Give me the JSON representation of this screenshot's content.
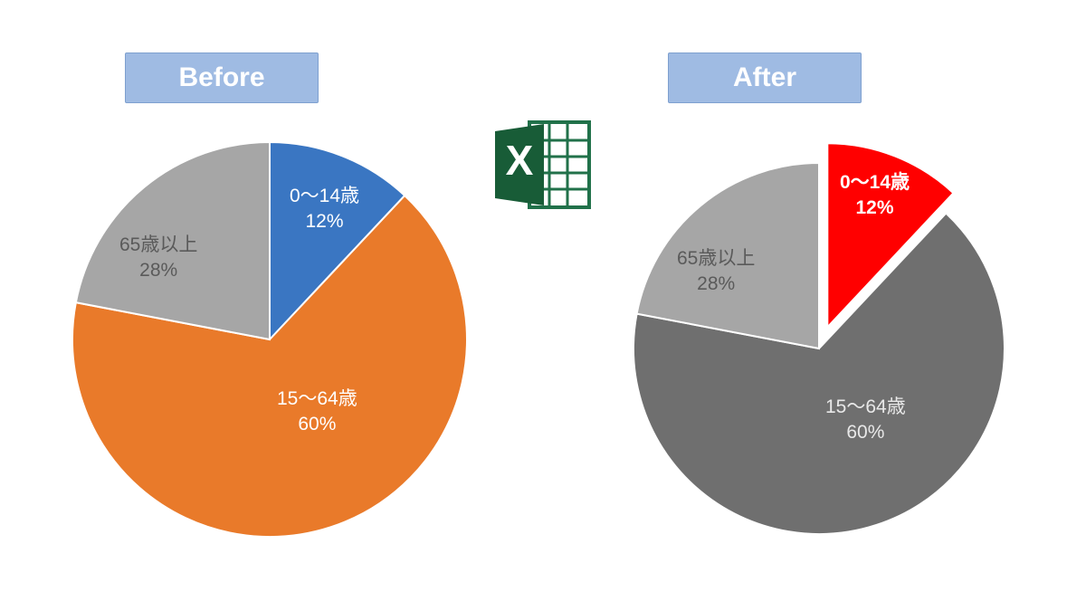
{
  "titles": {
    "before": "Before",
    "after": "After"
  },
  "chart_data": [
    {
      "id": "before",
      "type": "pie",
      "title": "Before",
      "series": [
        {
          "name": "0～14歳",
          "value": 12,
          "label": "12%",
          "color": "#3a76c2"
        },
        {
          "name": "15～64歳",
          "value": 60,
          "label": "60%",
          "color": "#e97a2a"
        },
        {
          "name": "65歳以上",
          "value": 28,
          "label": "28%",
          "color": "#a6a6a6"
        }
      ],
      "exploded_index": null
    },
    {
      "id": "after",
      "type": "pie",
      "title": "After",
      "series": [
        {
          "name": "0～14歳",
          "value": 12,
          "label": "12%",
          "color": "#ff0000"
        },
        {
          "name": "15～64歳",
          "value": 60,
          "label": "60%",
          "color": "#6f6f6f"
        },
        {
          "name": "65歳以上",
          "value": 28,
          "label": "28%",
          "color": "#a6a6a6"
        }
      ],
      "exploded_index": 0
    }
  ],
  "icon": {
    "name": "excel-icon"
  },
  "colors": {
    "pill_bg": "#9fbbe3",
    "pill_text": "#ffffff"
  }
}
